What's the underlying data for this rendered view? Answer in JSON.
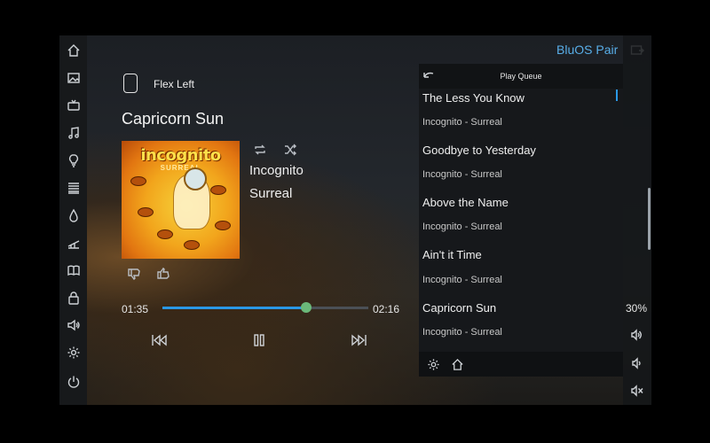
{
  "header": {
    "brand": "BluOS Pair"
  },
  "left_nav": {
    "icons": [
      "home-icon",
      "picture-icon",
      "tv-icon",
      "music-icon",
      "lightbulb-icon",
      "shades-icon",
      "water-drop-icon",
      "rail-icon",
      "book-icon",
      "lock-icon",
      "speaker-icon",
      "gear-icon",
      "power-icon"
    ]
  },
  "now_playing": {
    "device": "Flex Left",
    "title": "Capricorn Sun",
    "artist": "Incognito",
    "album": "Surreal",
    "album_art_text": {
      "logo": "incognito",
      "subtitle": "SURREAL"
    },
    "elapsed": "01:35",
    "duration": "02:16",
    "progress": 0.7,
    "repeat_icon": "repeat-icon",
    "shuffle_icon": "shuffle-icon",
    "thumb_down_icon": "thumbs-down-icon",
    "thumb_up_icon": "thumbs-up-icon",
    "transport": [
      "previous-icon",
      "pause-icon",
      "next-icon"
    ]
  },
  "queue": {
    "title": "Play Queue",
    "items": [
      {
        "title": "The Less You Know",
        "subtitle": "Incognito - Surreal"
      },
      {
        "title": "Goodbye to Yesterday",
        "subtitle": "Incognito - Surreal"
      },
      {
        "title": "Above the Name",
        "subtitle": "Incognito - Surreal"
      },
      {
        "title": "Ain't it Time",
        "subtitle": "Incognito - Surreal"
      },
      {
        "title": "Capricorn Sun",
        "subtitle": "Incognito - Surreal"
      }
    ],
    "footer_icons": [
      "gear-icon",
      "home-icon"
    ]
  },
  "volume": {
    "percent": "30%",
    "level": 0.3
  },
  "colors": {
    "accent": "#2a98e6",
    "brand": "#58aee8",
    "thumb": "#6bb97a"
  }
}
